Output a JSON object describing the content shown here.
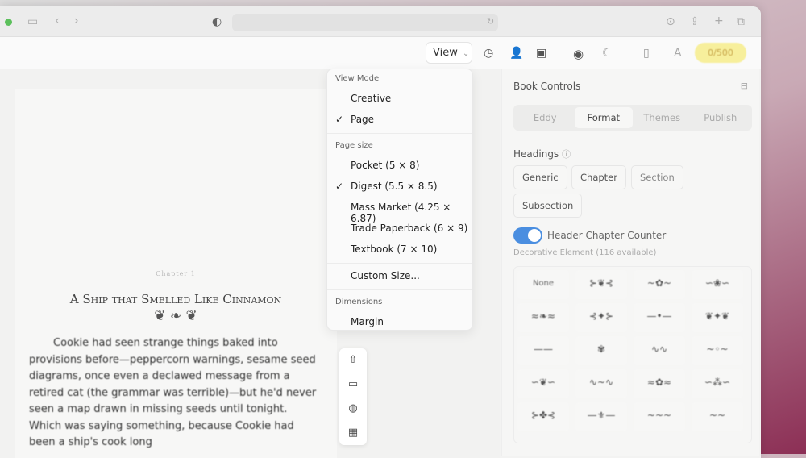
{
  "toolbar": {
    "view_label": "View",
    "counter": "0/500"
  },
  "chapter": {
    "label": "Chapter 1",
    "title": "A Ship that Smelled Like Cinnamon",
    "ornament": "❦ ❧ ❦",
    "text": "Cookie had seen strange things baked into provisions before—peppercorn warnings, sesame seed diagrams, once even a declawed message from a retired cat (the grammar was terrible)—but he'd never seen a map drawn in missing seeds until tonight. Which was saying something, because Cookie had been a ship's cook long"
  },
  "menu": {
    "view_mode_header": "View Mode",
    "view_modes": [
      {
        "label": "Creative",
        "checked": false
      },
      {
        "label": "Page",
        "checked": true
      }
    ],
    "page_size_header": "Page size",
    "page_sizes": [
      {
        "label": "Pocket (5 × 8)",
        "checked": false
      },
      {
        "label": "Digest (5.5 × 8.5)",
        "checked": true
      },
      {
        "label": "Mass Market (4.25 × 6.87)",
        "checked": false
      },
      {
        "label": "Trade Paperback (6 × 9)",
        "checked": false
      },
      {
        "label": "Textbook (7 × 10)",
        "checked": false
      }
    ],
    "custom_size": "Custom Size...",
    "dimensions_header": "Dimensions",
    "margin": "Margin",
    "check": "✓"
  },
  "panel": {
    "title": "Book Controls",
    "tabs": [
      "Eddy",
      "Format",
      "Themes",
      "Publish"
    ],
    "active_tab": "Format",
    "headings_label": "Headings",
    "heading_types": [
      "Generic",
      "Chapter",
      "Section",
      "Subsection"
    ],
    "toggle_label": "Header Chapter Counter",
    "toggle_on": true,
    "decor_label": "Decorative Element (116 available)",
    "decor_none": "None",
    "decor_glyphs": [
      "⊱❦⊰",
      "~✿~",
      "∽❀∽",
      "≈❧≈",
      "⊰✦⊱",
      "—•—",
      "❦✦❦",
      "——",
      "✾",
      "∿∿",
      "~◦~",
      "∽❦∽",
      "∿~∿",
      "≈✿≈",
      "∽⁂∽",
      "⊱✤⊰",
      "—⚜—",
      "~~~",
      "~~"
    ]
  },
  "accent": "#4a8ee0"
}
